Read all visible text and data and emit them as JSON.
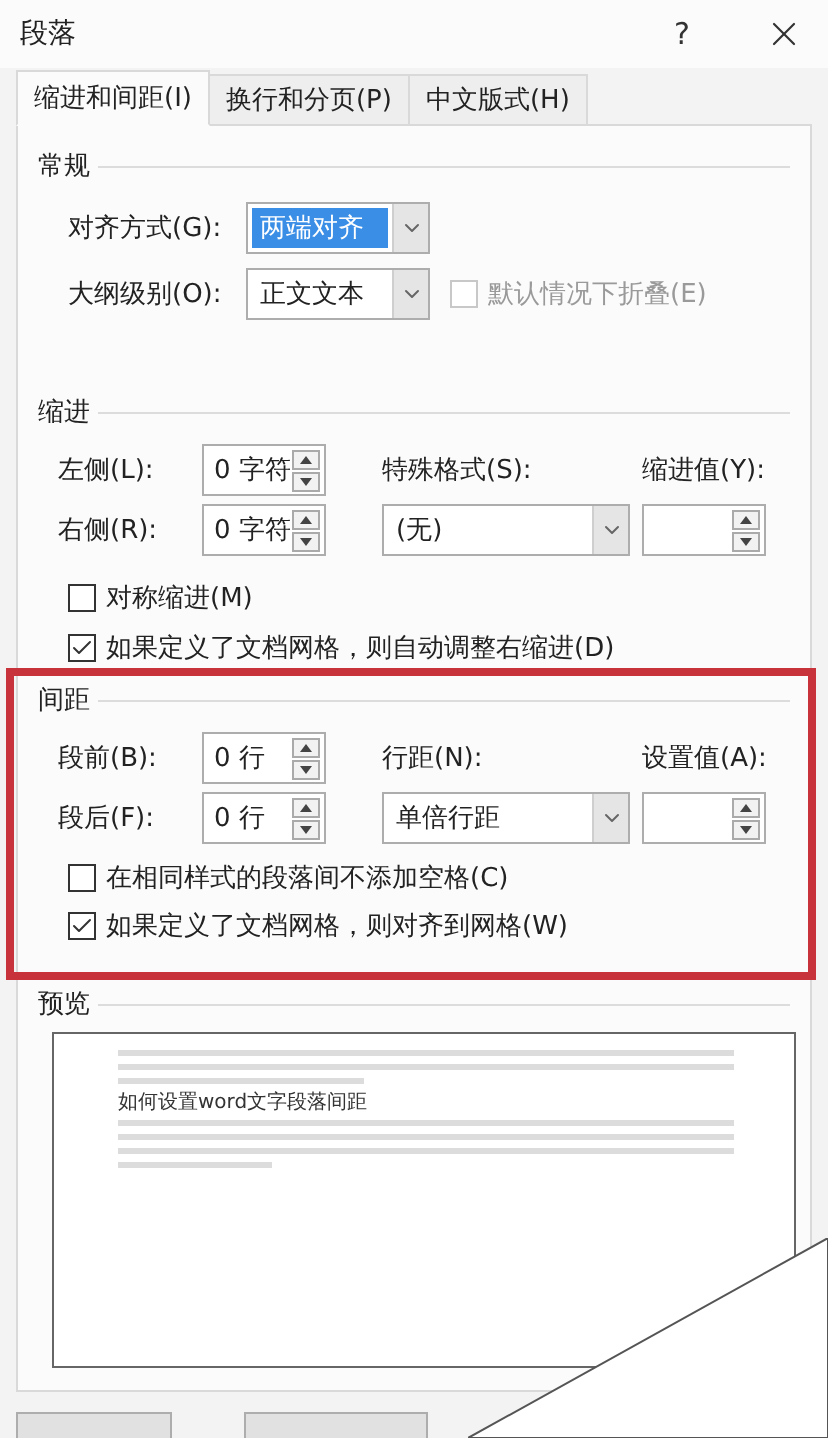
{
  "window": {
    "title": "段落",
    "help": "?"
  },
  "tabs": [
    {
      "label": "缩进和间距(I)",
      "selected": true
    },
    {
      "label": "换行和分页(P)",
      "selected": false
    },
    {
      "label": "中文版式(H)",
      "selected": false
    }
  ],
  "general": {
    "legend": "常规",
    "alignment": {
      "label": "对齐方式(G):",
      "value": "两端对齐",
      "focused": true
    },
    "outline": {
      "label": "大纲级别(O):",
      "value": "正文文本",
      "focused": false
    },
    "collapse": {
      "label": "默认情况下折叠(E)",
      "checked": false,
      "disabled": true
    }
  },
  "indent": {
    "legend": "缩进",
    "left": {
      "label": "左侧(L):",
      "value": "0 字符"
    },
    "right": {
      "label": "右侧(R):",
      "value": "0 字符"
    },
    "special": {
      "label": "特殊格式(S):",
      "value": "(无)"
    },
    "by": {
      "label": "缩进值(Y):"
    },
    "mirror": {
      "label": "对称缩进(M)",
      "checked": false,
      "disabled": false
    },
    "auto_adjust": {
      "label": "如果定义了文档网格，则自动调整右缩进(D)",
      "checked": true,
      "disabled": false
    }
  },
  "spacing": {
    "legend": "间距",
    "highlighted": true,
    "before": {
      "label": "段前(B):",
      "value": "0 行"
    },
    "after": {
      "label": "段后(F):",
      "value": "0 行"
    },
    "line_spacing": {
      "label": "行距(N):",
      "value": "单倍行距"
    },
    "at": {
      "label": "设置值(A):"
    },
    "no_space": {
      "label": "在相同样式的段落间不添加空格(C)",
      "checked": false,
      "disabled": false
    },
    "snap": {
      "label": "如果定义了文档网格，则对齐到网格(W)",
      "checked": true,
      "disabled": false
    }
  },
  "preview": {
    "legend": "预览",
    "sample": "如何设置word文字段落间距"
  }
}
